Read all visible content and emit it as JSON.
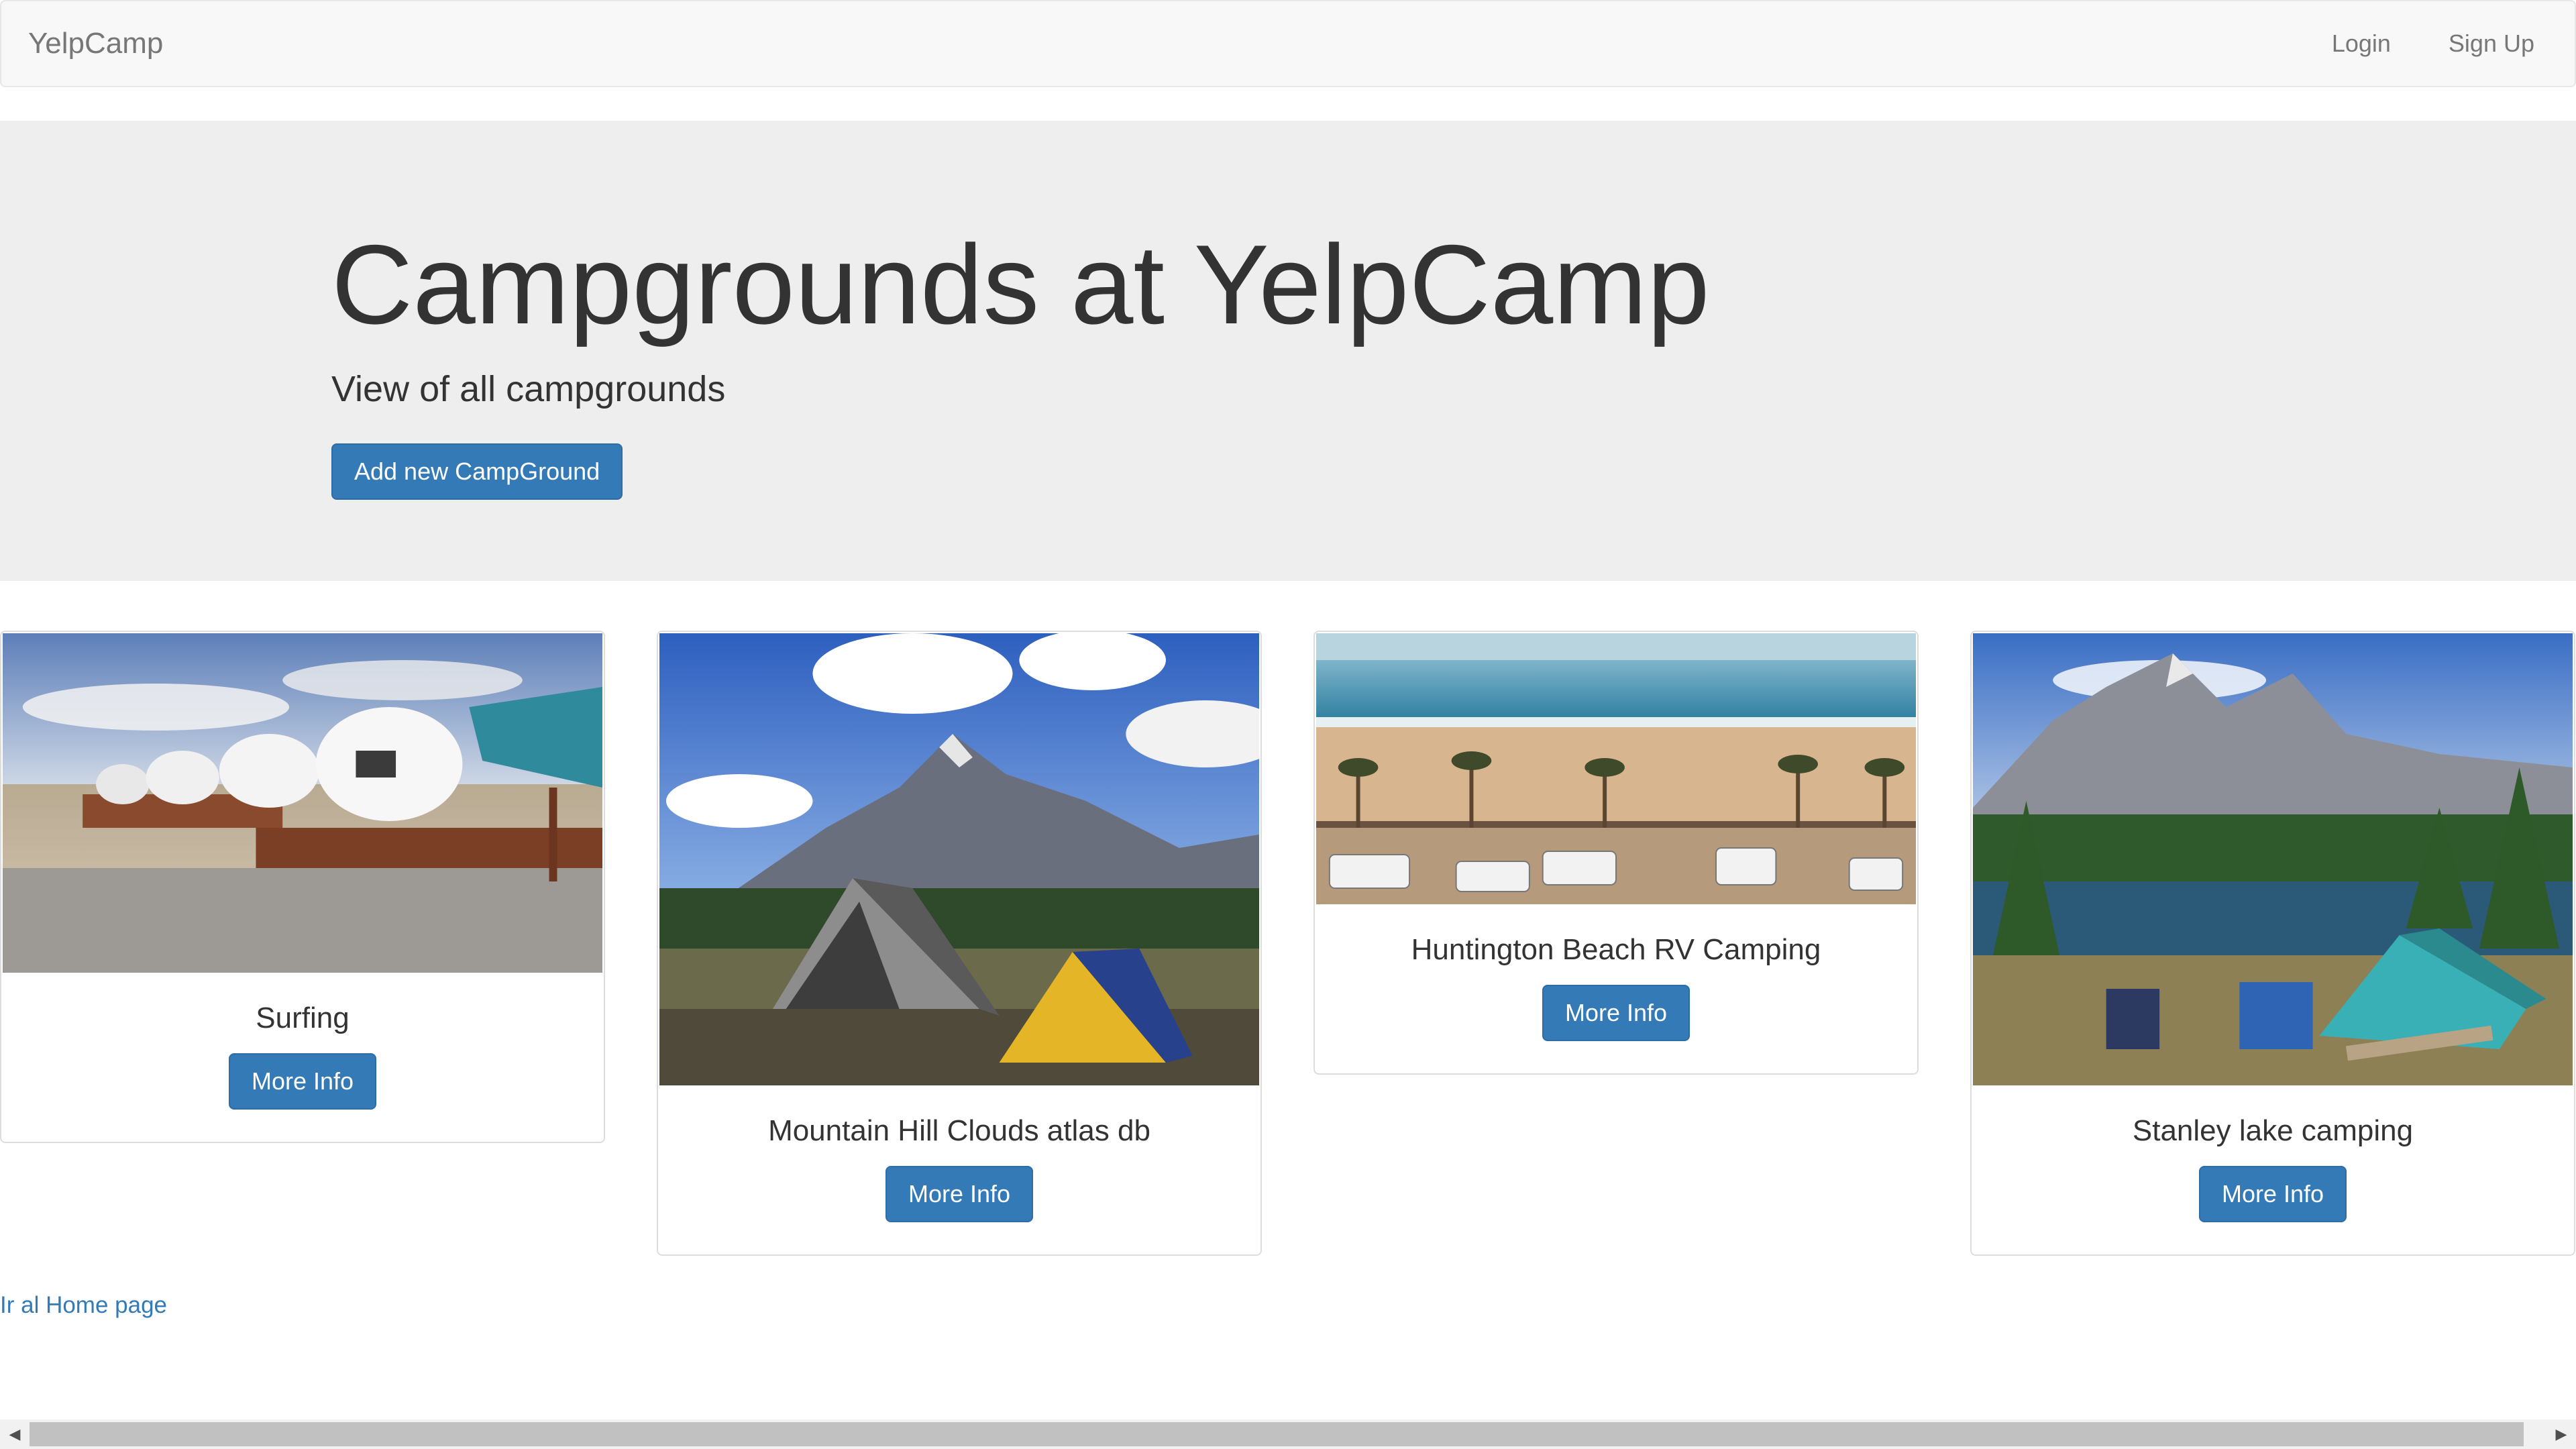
{
  "navbar": {
    "brand": "YelpCamp",
    "links": [
      {
        "label": "Login"
      },
      {
        "label": "Sign Up"
      }
    ]
  },
  "jumbotron": {
    "title": "Campgrounds at YelpCamp",
    "subtitle": "View of all campgrounds",
    "add_button": "Add new CampGround"
  },
  "campgrounds": [
    {
      "name": "Surfing",
      "button": "More Info",
      "image": "beach-domes-photo"
    },
    {
      "name": "Mountain Hill Clouds atlas db",
      "button": "More Info",
      "image": "mountain-tents-photo"
    },
    {
      "name": "Huntington Beach RV Camping",
      "button": "More Info",
      "image": "beach-rv-photo"
    },
    {
      "name": "Stanley lake camping",
      "button": "More Info",
      "image": "lake-tent-photo"
    }
  ],
  "footer_link": "Ir al Home page",
  "colors": {
    "primary": "#337ab7",
    "navbar_bg": "#f8f8f8",
    "jumbotron_bg": "#eeeeee",
    "link": "#337ab7"
  },
  "scrollbar": {
    "left_icon": "caret-left-icon",
    "right_icon": "caret-right-icon"
  }
}
